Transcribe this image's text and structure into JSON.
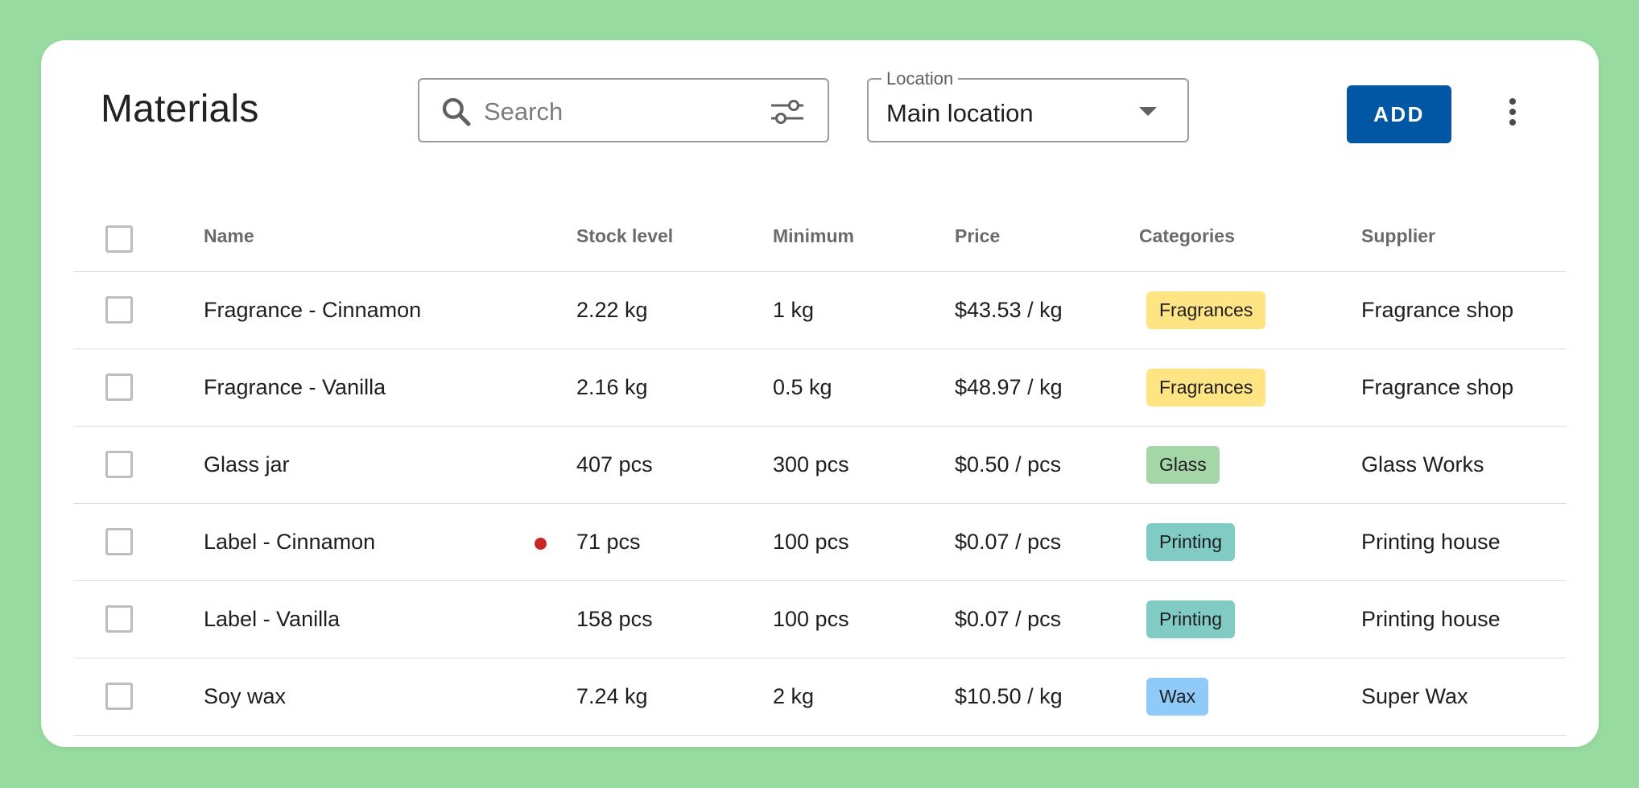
{
  "page": {
    "title": "Materials"
  },
  "search": {
    "placeholder": "Search"
  },
  "location": {
    "label": "Location",
    "value": "Main location"
  },
  "toolbar": {
    "add_label": "ADD"
  },
  "table": {
    "columns": [
      "Name",
      "Stock level",
      "Minimum",
      "Price",
      "Categories",
      "Supplier"
    ],
    "rows": [
      {
        "name": "Fragrance - Cinnamon",
        "stock": "2.22 kg",
        "minimum": "1 kg",
        "price": "$43.53 / kg",
        "category": "Fragrances",
        "supplier": "Fragrance shop",
        "low_stock": false
      },
      {
        "name": "Fragrance - Vanilla",
        "stock": "2.16 kg",
        "minimum": "0.5 kg",
        "price": "$48.97 / kg",
        "category": "Fragrances",
        "supplier": "Fragrance shop",
        "low_stock": false
      },
      {
        "name": "Glass jar",
        "stock": "407 pcs",
        "minimum": "300 pcs",
        "price": "$0.50 / pcs",
        "category": "Glass",
        "supplier": "Glass Works",
        "low_stock": false
      },
      {
        "name": "Label - Cinnamon",
        "stock": "71 pcs",
        "minimum": "100 pcs",
        "price": "$0.07 / pcs",
        "category": "Printing",
        "supplier": "Printing house",
        "low_stock": true
      },
      {
        "name": "Label - Vanilla",
        "stock": "158 pcs",
        "minimum": "100 pcs",
        "price": "$0.07 / pcs",
        "category": "Printing",
        "supplier": "Printing house",
        "low_stock": false
      },
      {
        "name": "Soy wax",
        "stock": "7.24 kg",
        "minimum": "2 kg",
        "price": "$10.50 / kg",
        "category": "Wax",
        "supplier": "Super Wax",
        "low_stock": false
      }
    ]
  },
  "colors": {
    "background": "#98dba0",
    "accent": "#0157a4",
    "low_stock_dot": "#c62828",
    "category_colors": {
      "Fragrances": "#ffe483",
      "Glass": "#a5d6a7",
      "Printing": "#80cbc4",
      "Wax": "#90caf9"
    }
  },
  "icons": {
    "search": "search-icon",
    "filter": "filter-sliders-icon",
    "dropdown": "chevron-down-icon",
    "more": "more-vertical-icon"
  }
}
